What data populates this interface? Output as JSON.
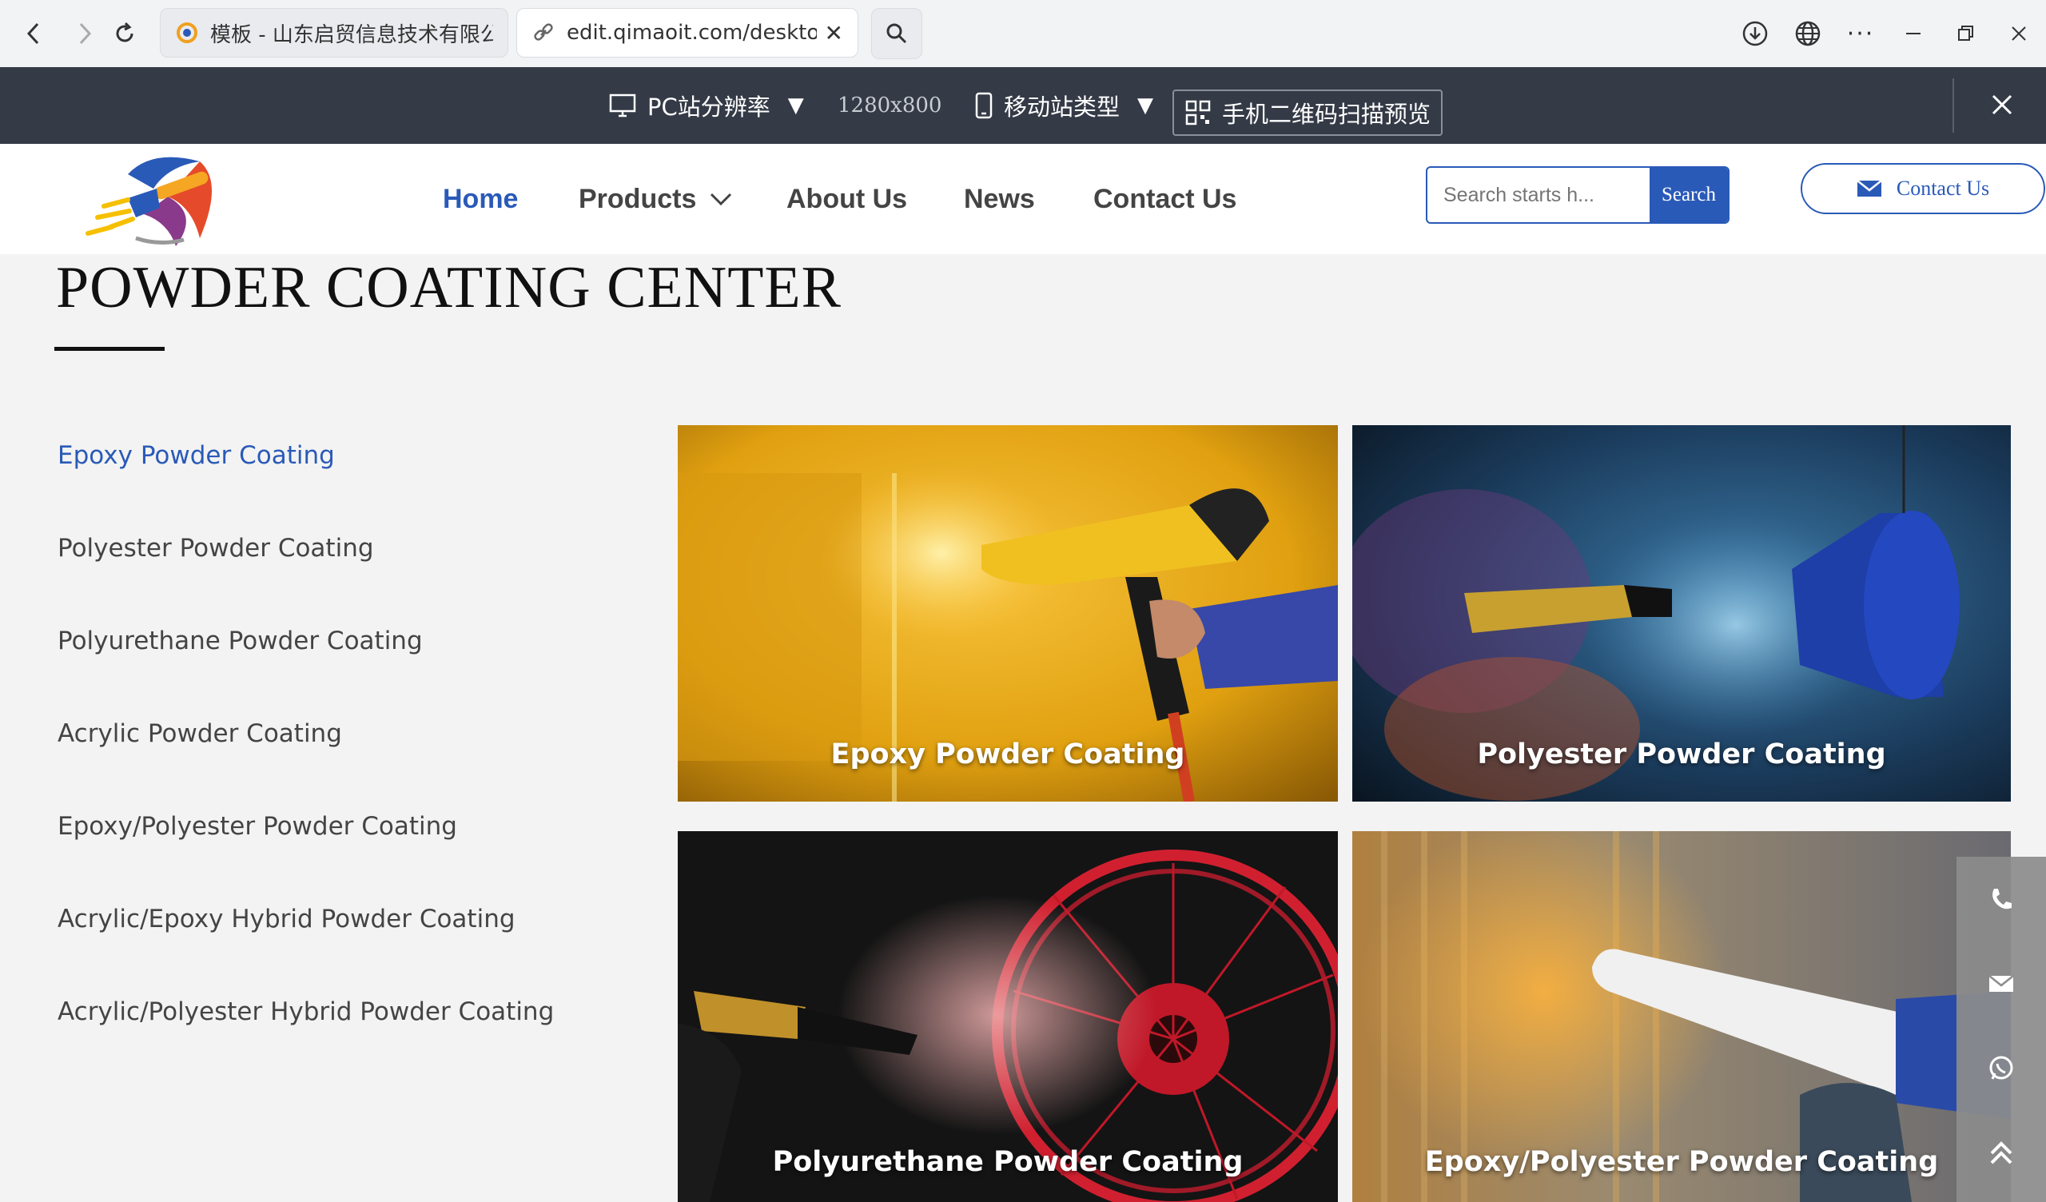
{
  "browser": {
    "tabs": [
      {
        "title": "模板 - 山东启贸信息技术有限公司",
        "active": false
      },
      {
        "title": "edit.qimaoit.com/desktop/h",
        "active": true
      }
    ]
  },
  "editor_bar": {
    "pc_label": "PC站分辨率",
    "resolution": "1280x800",
    "mobile_label": "移动站类型",
    "qr_label": "手机二维码扫描预览"
  },
  "header": {
    "nav": [
      {
        "label": "Home",
        "active": true
      },
      {
        "label": "Products",
        "has_dropdown": true
      },
      {
        "label": "About Us"
      },
      {
        "label": "News"
      },
      {
        "label": "Contact Us"
      }
    ],
    "search": {
      "placeholder": "Search starts h...",
      "button_label": "Search"
    },
    "contact_button": "Contact Us",
    "accent_color": "#2a5ab8"
  },
  "main": {
    "title": "POWDER COATING CENTER",
    "sidebar": [
      {
        "label": "Epoxy Powder Coating",
        "active": true
      },
      {
        "label": "Polyester Powder Coating"
      },
      {
        "label": "Polyurethane Powder Coating"
      },
      {
        "label": "Acrylic Powder Coating"
      },
      {
        "label": "Epoxy/Polyester Powder Coating"
      },
      {
        "label": "Acrylic/Epoxy Hybrid Powder Coating"
      },
      {
        "label": "Acrylic/Polyester Hybrid Powder Coating"
      }
    ],
    "cards": [
      {
        "label": "Epoxy Powder Coating"
      },
      {
        "label": "Polyester Powder Coating"
      },
      {
        "label": "Polyurethane Powder Coating"
      },
      {
        "label": "Epoxy/Polyester Powder Coating"
      }
    ]
  },
  "floating_tools": [
    "phone-icon",
    "mail-icon",
    "whatsapp-icon",
    "back-to-top-icon"
  ]
}
